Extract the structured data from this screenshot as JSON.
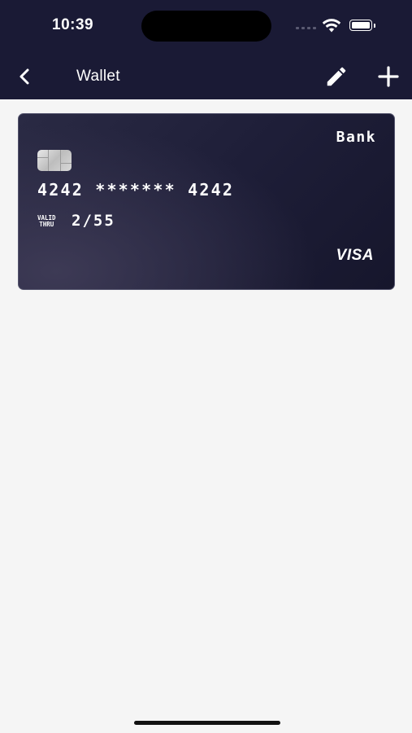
{
  "status_bar": {
    "time": "10:39",
    "icons": [
      "cellular-signal-icon",
      "wifi-icon",
      "battery-icon"
    ]
  },
  "nav": {
    "title": "Wallet",
    "back_icon": "chevron-left-icon",
    "edit_icon": "pencil-icon",
    "add_icon": "plus-icon"
  },
  "cards": [
    {
      "bank": "Bank",
      "number": "4242 ******* 4242",
      "valid_label_line1": "VALID",
      "valid_label_line2": "THRU",
      "expiry": "2/55",
      "network": "VISA"
    }
  ],
  "colors": {
    "header_bg": "#1a1a35",
    "page_bg": "#f5f5f5",
    "card_bg": "#1e1e38",
    "text_on_dark": "#ffffff"
  }
}
